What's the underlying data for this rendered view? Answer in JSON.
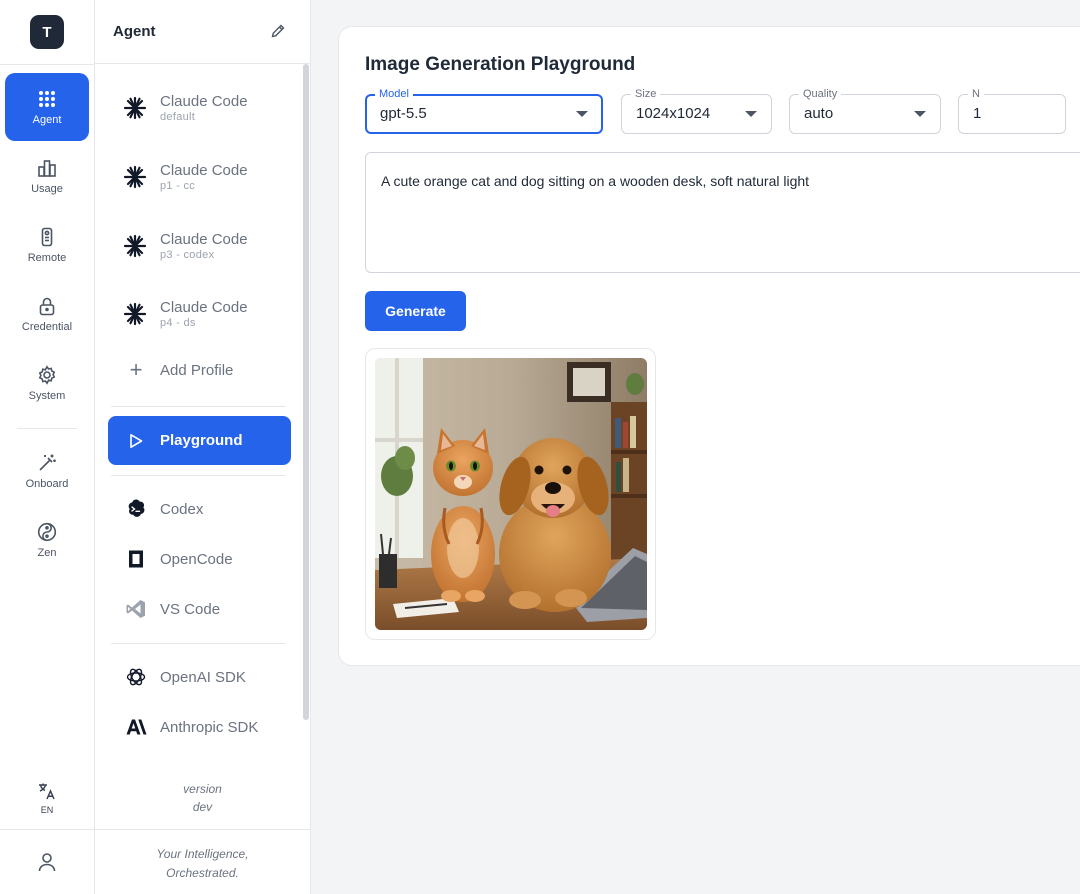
{
  "rail": {
    "logo": "T",
    "items": [
      {
        "label": "Agent",
        "icon": "grid-dots-icon",
        "active": true
      },
      {
        "label": "Usage",
        "icon": "bar-chart-icon"
      },
      {
        "label": "Remote",
        "icon": "remote-control-icon"
      },
      {
        "label": "Credential",
        "icon": "lock-icon"
      },
      {
        "label": "System",
        "icon": "gear-icon"
      },
      {
        "label": "Onboard",
        "icon": "magic-wand-icon"
      },
      {
        "label": "Zen",
        "icon": "yin-yang-icon"
      }
    ],
    "language": "EN"
  },
  "sidebar": {
    "title": "Agent",
    "profiles": [
      {
        "name": "Claude Code",
        "sub": "default"
      },
      {
        "name": "Claude Code",
        "sub": "p1 - cc"
      },
      {
        "name": "Claude Code",
        "sub": "p3 - codex"
      },
      {
        "name": "Claude Code",
        "sub": "p4 - ds"
      }
    ],
    "add_profile": "Add Profile",
    "playground": "Playground",
    "tools": [
      {
        "label": "Codex",
        "icon": "codex-icon"
      },
      {
        "label": "OpenCode",
        "icon": "opencode-icon"
      },
      {
        "label": "VS Code",
        "icon": "vscode-icon"
      }
    ],
    "sdks": [
      {
        "label": "OpenAI SDK",
        "icon": "openai-icon"
      },
      {
        "label": "Anthropic SDK",
        "icon": "anthropic-icon"
      }
    ],
    "version_label": "version",
    "version_value": "dev",
    "tagline_1": "Your Intelligence,",
    "tagline_2": "Orchestrated."
  },
  "main": {
    "title": "Image Generation Playground",
    "model": {
      "label": "Model",
      "value": "gpt-5.5"
    },
    "size": {
      "label": "Size",
      "value": "1024x1024"
    },
    "quality": {
      "label": "Quality",
      "value": "auto"
    },
    "n": {
      "label": "N",
      "value": "1"
    },
    "prompt": "A cute orange cat and dog sitting on a wooden desk, soft natural light",
    "generate": "Generate"
  },
  "colors": {
    "accent": "#2563eb",
    "text": "#1f2937",
    "muted": "#6b7280",
    "background": "#f3f4f6"
  }
}
